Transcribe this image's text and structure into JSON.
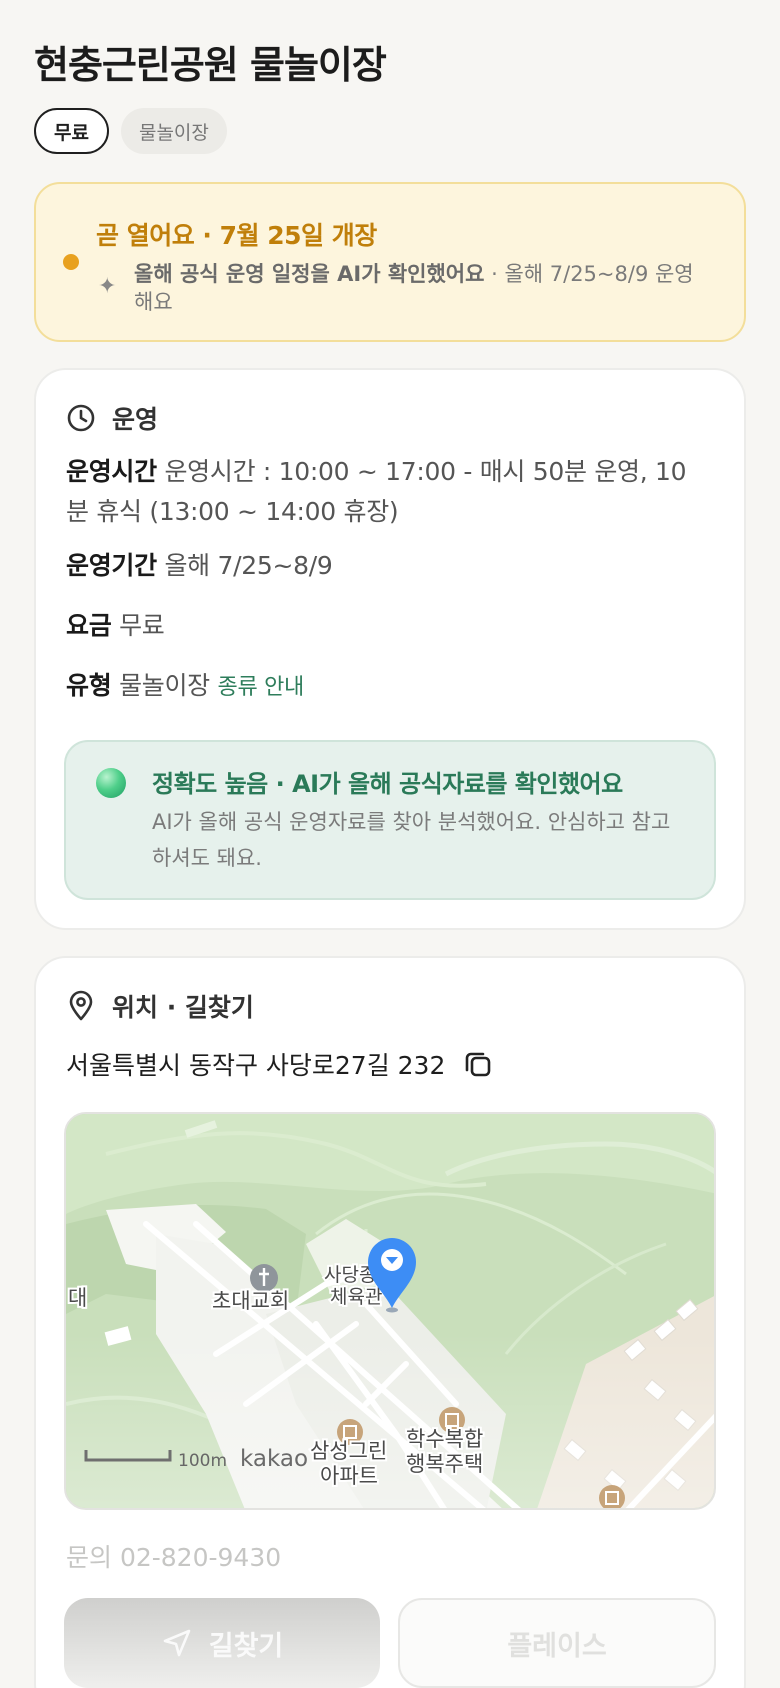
{
  "page": {
    "title": "현충근린공원 물놀이장",
    "chips": [
      "무료",
      "물놀이장"
    ]
  },
  "notice": {
    "headline": "곧 열어요 · 7월 25일 개장",
    "sub_bold": "올해 공식 운영 일정을 AI가 확인했어요",
    "sub_rest": " · 올해 7/25~8/9 운영해요",
    "accent": "#e8a11f"
  },
  "operation": {
    "section_label": "운영",
    "hours_label": "운영시간",
    "hours_value": "운영시간 : 10:00 ~ 17:00 - 매시 50분 운영, 10분 휴식 (13:00 ~ 14:00 휴장)",
    "period_label": "운영기간",
    "period_value": "올해 7/25~8/9",
    "fee_label": "요금",
    "fee_value": "무료",
    "type_label": "유형",
    "type_value": "물놀이장",
    "type_link": "종류 안내",
    "accuracy": {
      "headline": "정확도 높음 · AI가 올해 공식자료를 확인했어요",
      "desc": "AI가 올해 공식 운영자료를 찾아 분석했어요. 안심하고 참고하셔도 돼요.",
      "color": "#2a7a58"
    }
  },
  "location": {
    "section_label": "위치 · 길찾기",
    "address": "서울특별시 동작구 사당로27길 232",
    "map": {
      "labels": {
        "left_edge": "대",
        "church": "초대교회",
        "gym_line1": "사당종",
        "gym_line2": "체육관",
        "apt1_line1": "삼성그린",
        "apt1_line2": "아파트",
        "apt2_line1": "학수복합",
        "apt2_line2": "행복주택",
        "scale": "100m",
        "brand": "kakao"
      },
      "pin_color": "#3d8df5"
    },
    "phone": "문의 02-820-9430",
    "nav_button": "길찾기",
    "place_button": "플레이스"
  }
}
